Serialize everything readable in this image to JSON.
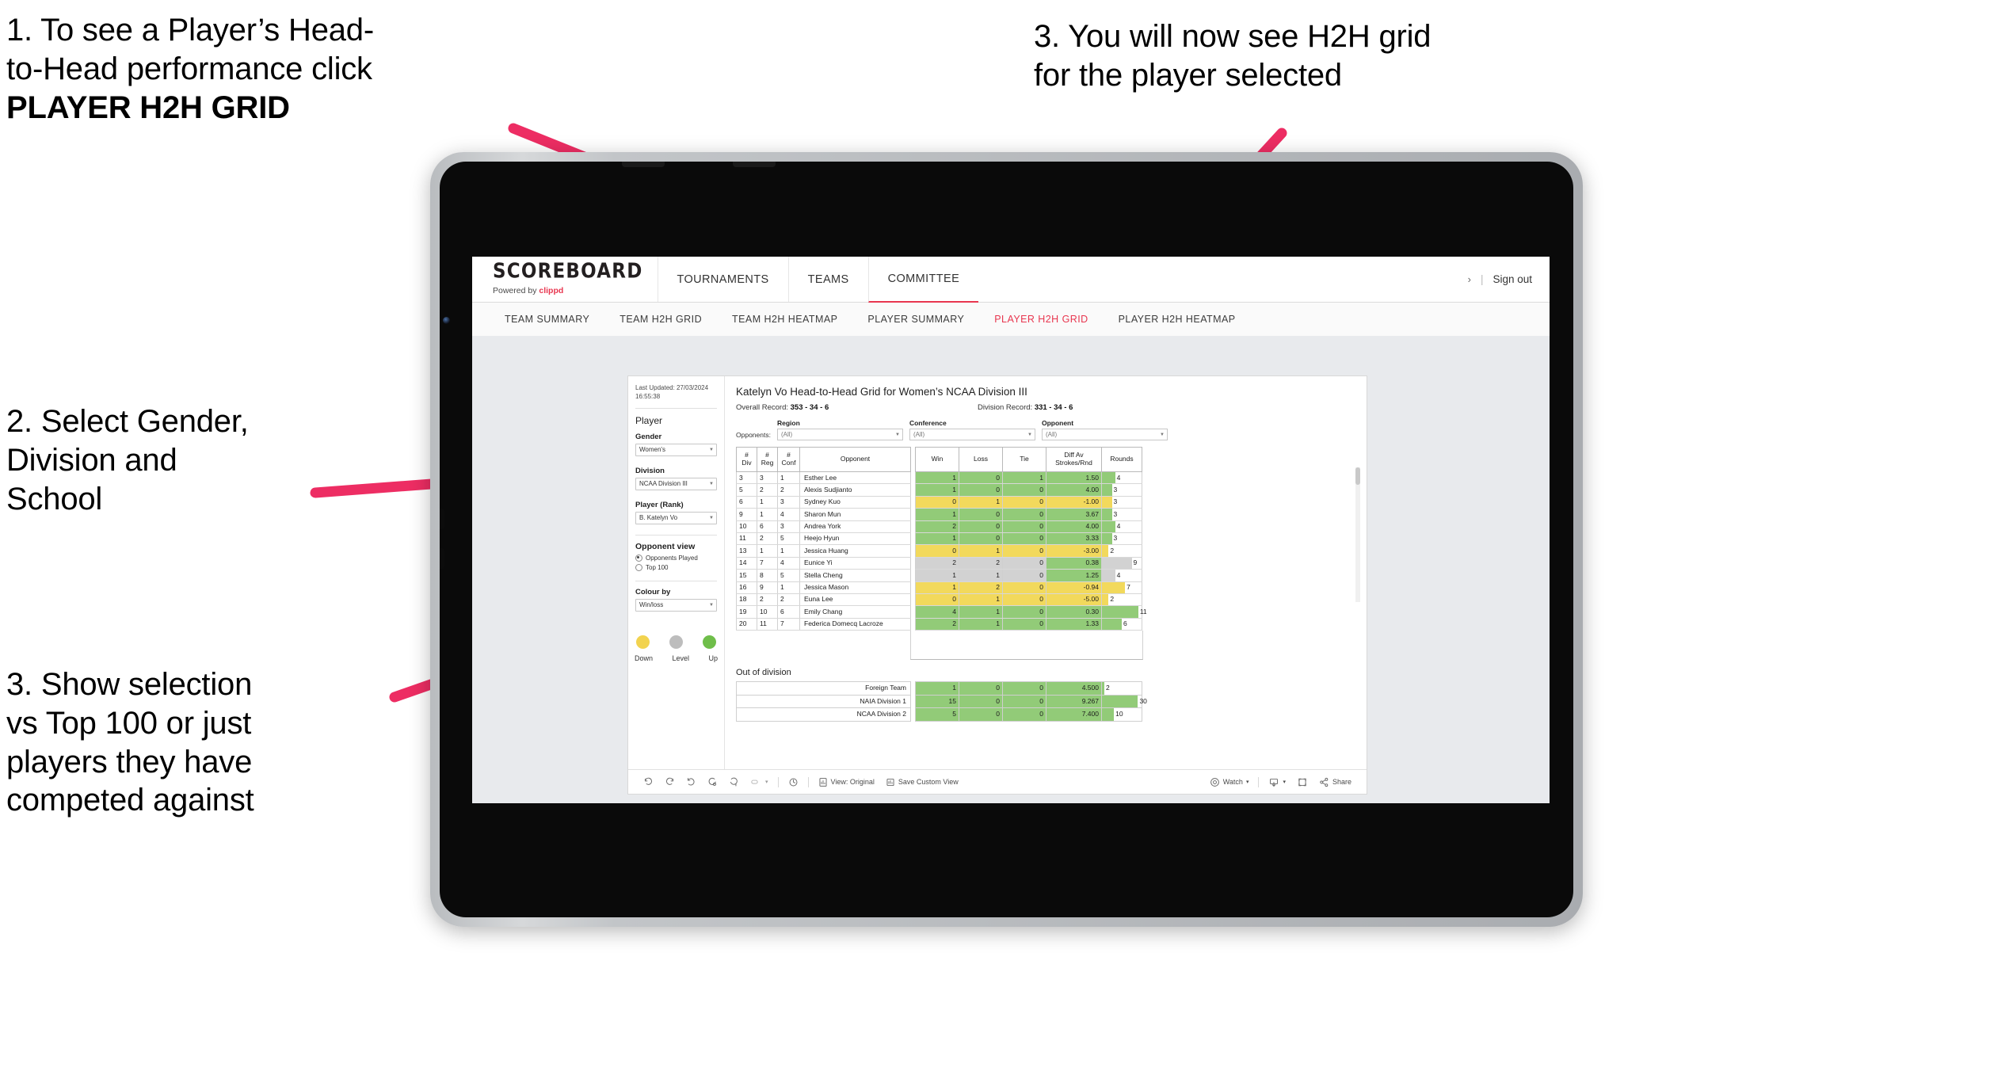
{
  "annotations": {
    "step1_line1": "1. To see a Player’s Head-",
    "step1_line2": "to-Head performance click",
    "step1_bold": "PLAYER H2H GRID",
    "step2_line1": "2. Select Gender,",
    "step2_line2": "Division and",
    "step2_line3": "School",
    "step3_left_line1": "3. Show selection",
    "step3_left_line2": "vs Top 100 or just",
    "step3_left_line3": "players they have",
    "step3_left_line4": "competed against",
    "step3_right_line1": "3. You will now see H2H grid",
    "step3_right_line2": "for the player selected",
    "arrow_color": "#ED2D63"
  },
  "header": {
    "logo": "SCOREBOARD",
    "powered_by_prefix": "Powered by ",
    "powered_by_brand": "clippd",
    "tabs": [
      {
        "label": "TOURNAMENTS",
        "active": false
      },
      {
        "label": "TEAMS",
        "active": false
      },
      {
        "label": "COMMITTEE",
        "active": true
      }
    ],
    "chevron": "›",
    "separator": "|",
    "sign_out": "Sign out"
  },
  "subnav": {
    "tabs": [
      {
        "label": "TEAM SUMMARY",
        "active": false
      },
      {
        "label": "TEAM H2H GRID",
        "active": false
      },
      {
        "label": "TEAM H2H HEATMAP",
        "active": false
      },
      {
        "label": "PLAYER SUMMARY",
        "active": false
      },
      {
        "label": "PLAYER H2H GRID",
        "active": true
      },
      {
        "label": "PLAYER H2H HEATMAP",
        "active": false
      }
    ],
    "active_color": "#E8364F"
  },
  "sidebar": {
    "last_updated": "Last Updated: 27/03/2024 16:55:38",
    "player_heading": "Player",
    "gender_label": "Gender",
    "gender_value": "Women's",
    "division_label": "Division",
    "division_value": "NCAA Division III",
    "player_rank_label": "Player (Rank)",
    "player_rank_value": "B. Katelyn Vo",
    "opponent_view_heading": "Opponent view",
    "radio_opponents_played": "Opponents Played",
    "radio_top_100": "Top 100",
    "colour_by_label": "Colour by",
    "colour_by_value": "Win/loss",
    "legend": [
      {
        "label": "Down",
        "color": "#F2D34F"
      },
      {
        "label": "Level",
        "color": "#BDBDBD"
      },
      {
        "label": "Up",
        "color": "#6FBE4A"
      }
    ]
  },
  "viz": {
    "title": "Katelyn Vo Head-to-Head Grid for Women’s NCAA Division III",
    "overall_record_label": "Overall Record:",
    "overall_record_value": "353 -  34 - 6",
    "division_record_label": "Division Record:",
    "division_record_value": "331 -  34 - 6",
    "opponents_label": "Opponents:",
    "filters": [
      {
        "label": "Region",
        "value": "(All)"
      },
      {
        "label": "Conference",
        "value": "(All)"
      },
      {
        "label": "Opponent",
        "value": "(All)"
      }
    ],
    "out_of_division_title": "Out of division"
  },
  "chart_data": {
    "type": "table",
    "title": "Katelyn Vo Head-to-Head Grid for Women’s NCAA Division III",
    "columns": [
      "# Div",
      "# Reg",
      "# Conf",
      "Opponent",
      "Win",
      "Loss",
      "Tie",
      "Diff Av Strokes/Rnd",
      "Rounds"
    ],
    "column_header_lines": [
      [
        "#",
        "Div"
      ],
      [
        "#",
        "Reg"
      ],
      [
        "#",
        "Conf"
      ],
      [
        "Opponent",
        ""
      ],
      [
        "Win",
        ""
      ],
      [
        "Loss",
        ""
      ],
      [
        "Tie",
        ""
      ],
      [
        "Diff Av",
        "Strokes/Rnd"
      ],
      [
        "Rounds",
        ""
      ]
    ],
    "rounds_max": 12,
    "colors": {
      "up": "#92CB78",
      "down": "#F2D95C",
      "level": "#D2D2D2"
    },
    "rows": [
      {
        "div": "3",
        "reg": "3",
        "conf": "1",
        "opponent": "Esther Lee",
        "win": "1",
        "loss": "0",
        "tie": "1",
        "diff": "1.50",
        "rounds": 4,
        "state": "up"
      },
      {
        "div": "5",
        "reg": "2",
        "conf": "2",
        "opponent": "Alexis Sudjianto",
        "win": "1",
        "loss": "0",
        "tie": "0",
        "diff": "4.00",
        "rounds": 3,
        "state": "up"
      },
      {
        "div": "6",
        "reg": "1",
        "conf": "3",
        "opponent": "Sydney Kuo",
        "win": "0",
        "loss": "1",
        "tie": "0",
        "diff": "-1.00",
        "rounds": 3,
        "state": "down"
      },
      {
        "div": "9",
        "reg": "1",
        "conf": "4",
        "opponent": "Sharon Mun",
        "win": "1",
        "loss": "0",
        "tie": "0",
        "diff": "3.67",
        "rounds": 3,
        "state": "up"
      },
      {
        "div": "10",
        "reg": "6",
        "conf": "3",
        "opponent": "Andrea York",
        "win": "2",
        "loss": "0",
        "tie": "0",
        "diff": "4.00",
        "rounds": 4,
        "state": "up"
      },
      {
        "div": "11",
        "reg": "2",
        "conf": "5",
        "opponent": "Heejo Hyun",
        "win": "1",
        "loss": "0",
        "tie": "0",
        "diff": "3.33",
        "rounds": 3,
        "state": "up"
      },
      {
        "div": "13",
        "reg": "1",
        "conf": "1",
        "opponent": "Jessica Huang",
        "win": "0",
        "loss": "1",
        "tie": "0",
        "diff": "-3.00",
        "rounds": 2,
        "state": "down"
      },
      {
        "div": "14",
        "reg": "7",
        "conf": "4",
        "opponent": "Eunice Yi",
        "win": "2",
        "loss": "2",
        "tie": "0",
        "diff": "0.38",
        "rounds": 9,
        "state": "level",
        "diff_state": "up"
      },
      {
        "div": "15",
        "reg": "8",
        "conf": "5",
        "opponent": "Stella Cheng",
        "win": "1",
        "loss": "1",
        "tie": "0",
        "diff": "1.25",
        "rounds": 4,
        "state": "level",
        "diff_state": "up"
      },
      {
        "div": "16",
        "reg": "9",
        "conf": "1",
        "opponent": "Jessica Mason",
        "win": "1",
        "loss": "2",
        "tie": "0",
        "diff": "-0.94",
        "rounds": 7,
        "state": "down"
      },
      {
        "div": "18",
        "reg": "2",
        "conf": "2",
        "opponent": "Euna Lee",
        "win": "0",
        "loss": "1",
        "tie": "0",
        "diff": "-5.00",
        "rounds": 2,
        "state": "down"
      },
      {
        "div": "19",
        "reg": "10",
        "conf": "6",
        "opponent": "Emily Chang",
        "win": "4",
        "loss": "1",
        "tie": "0",
        "diff": "0.30",
        "rounds": 11,
        "state": "up"
      },
      {
        "div": "20",
        "reg": "11",
        "conf": "7",
        "opponent": "Federica Domecq Lacroze",
        "win": "2",
        "loss": "1",
        "tie": "0",
        "diff": "1.33",
        "rounds": 6,
        "state": "up"
      }
    ],
    "out_of_division_rows": [
      {
        "opponent": "Foreign Team",
        "win": "1",
        "loss": "0",
        "tie": "0",
        "diff": "4.500",
        "rounds": 2,
        "state": "up"
      },
      {
        "opponent": "NAIA Division 1",
        "win": "15",
        "loss": "0",
        "tie": "0",
        "diff": "9.267",
        "rounds": 30,
        "state": "up"
      },
      {
        "opponent": "NCAA Division 2",
        "win": "5",
        "loss": "0",
        "tie": "0",
        "diff": "7.400",
        "rounds": 10,
        "state": "up"
      }
    ],
    "out_of_division_rounds_max": 33
  },
  "toolbar": {
    "view_original": "View: Original",
    "save_custom_view": "Save Custom View",
    "watch": "Watch",
    "share": "Share",
    "caret": "▾"
  }
}
